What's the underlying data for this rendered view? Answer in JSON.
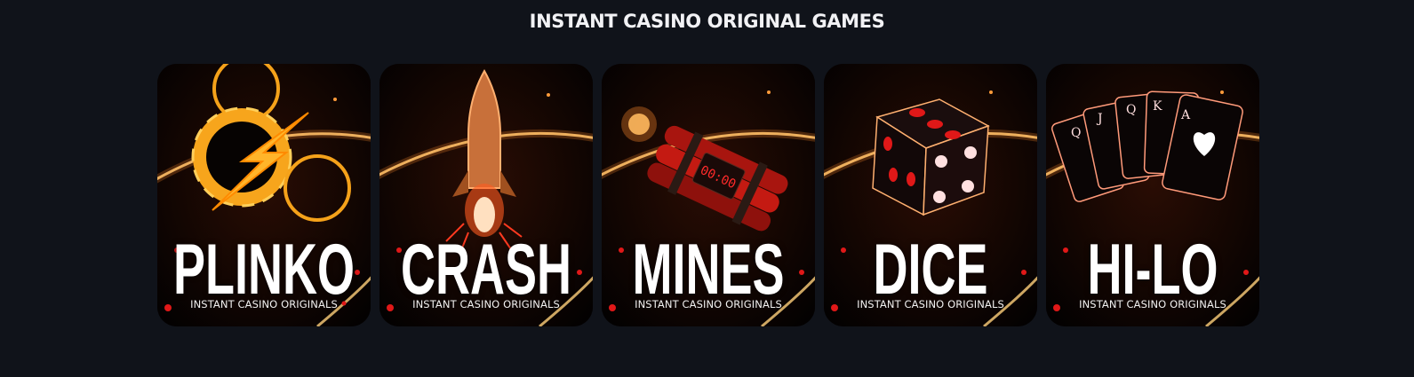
{
  "section": {
    "title": "INSTANT CASINO ORIGINAL GAMES"
  },
  "colors": {
    "background": "#10131a",
    "card": "#050202",
    "glow": "#ffb347",
    "accent_red": "#e01818"
  },
  "games": [
    {
      "title": "PLINKO",
      "subtitle": "INSTANT CASINO ORIGINALS",
      "icon": "lightning-chip-icon"
    },
    {
      "title": "CRASH",
      "subtitle": "INSTANT CASINO ORIGINALS",
      "icon": "rocket-icon"
    },
    {
      "title": "MINES",
      "subtitle": "INSTANT CASINO ORIGINALS",
      "icon": "dynamite-icon"
    },
    {
      "title": "DICE",
      "subtitle": "INSTANT CASINO ORIGINALS",
      "icon": "dice-icon"
    },
    {
      "title": "HI-LO",
      "subtitle": "INSTANT CASINO ORIGINALS",
      "icon": "playing-cards-icon"
    }
  ]
}
